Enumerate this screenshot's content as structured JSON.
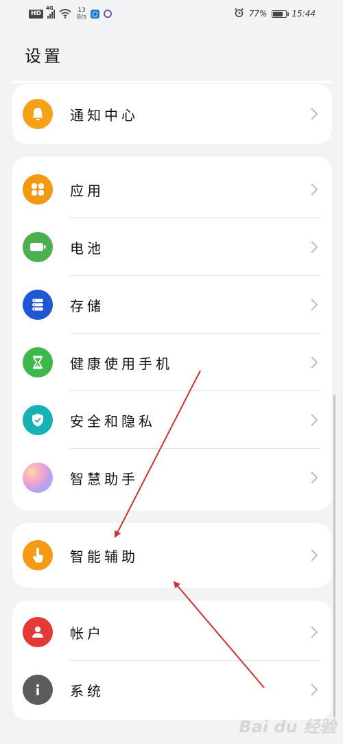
{
  "status_bar": {
    "hd": "HD",
    "network": "4G",
    "speed_value": "13",
    "speed_unit": "B/s",
    "battery_percent": "77%",
    "battery_level": 0.77,
    "time": "15:44"
  },
  "page": {
    "title": "设置"
  },
  "groups": [
    {
      "items": [
        {
          "label": "通知中心",
          "icon": "bell-icon",
          "color": "#f5a219"
        }
      ]
    },
    {
      "items": [
        {
          "label": "应用",
          "icon": "apps-grid-icon",
          "color": "#f39a12"
        },
        {
          "label": "电池",
          "icon": "battery-icon",
          "color": "#4caf50"
        },
        {
          "label": "存储",
          "icon": "storage-icon",
          "color": "#1e56d4"
        },
        {
          "label": "健康使用手机",
          "icon": "hourglass-icon",
          "color": "#3cb94a"
        },
        {
          "label": "安全和隐私",
          "icon": "shield-check-icon",
          "color": "#14b2b2"
        },
        {
          "label": "智慧助手",
          "icon": "assistant-orb-icon",
          "color": "#d8a6e8"
        }
      ]
    },
    {
      "items": [
        {
          "label": "智能辅助",
          "icon": "hand-tap-icon",
          "color": "#f59a14"
        }
      ]
    },
    {
      "items": [
        {
          "label": "帐户",
          "icon": "user-icon",
          "color": "#e53935"
        },
        {
          "label": "系统",
          "icon": "info-icon",
          "color": "#5c5c5c"
        }
      ]
    }
  ],
  "watermark": "Bai du 经验"
}
